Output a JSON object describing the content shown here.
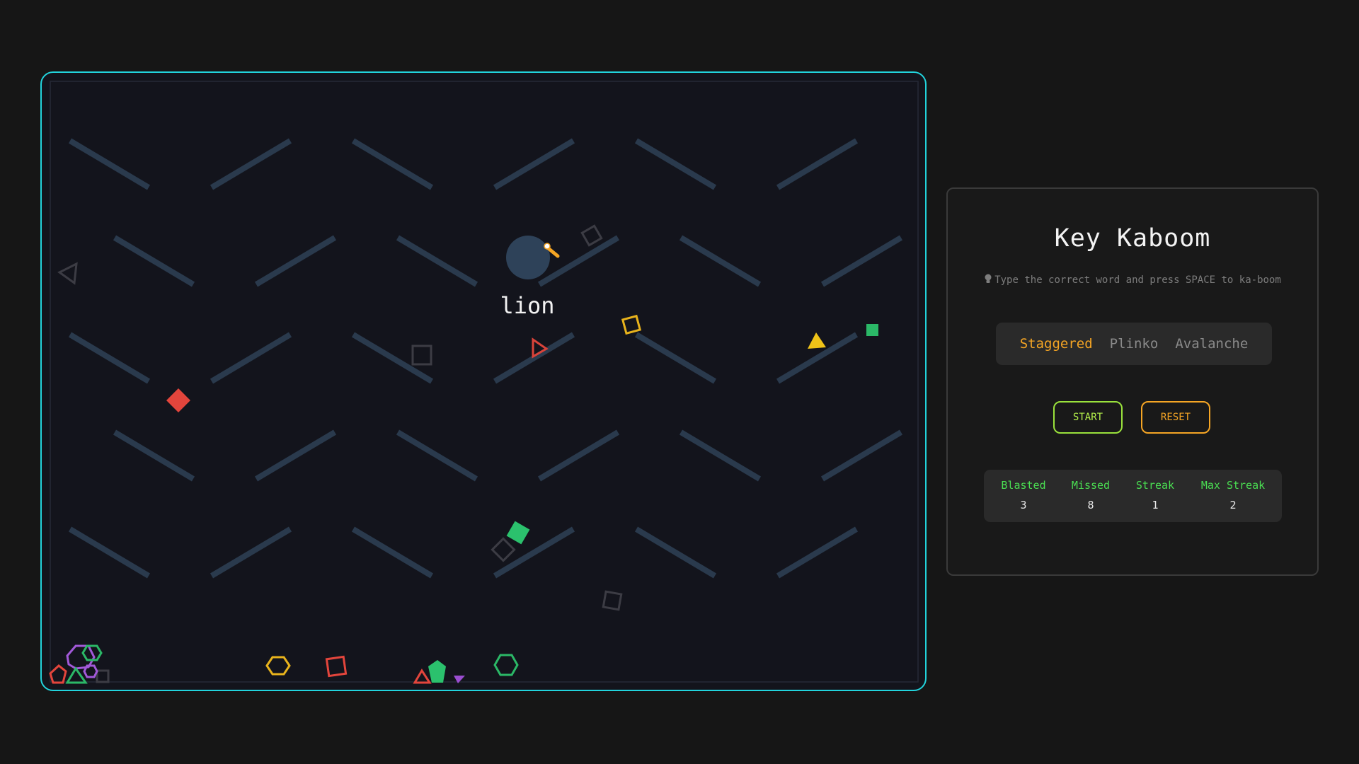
{
  "game": {
    "word": "lion",
    "colors": {
      "frame": "#22d3dc",
      "board": "#13141c",
      "peg": "#2a3a4d",
      "ball": "#2e4259",
      "fuse": "#f5a524"
    }
  },
  "panel": {
    "title": "Key Kaboom",
    "hint": "Type the correct word and press SPACE to ka-boom",
    "hint_icon": "lightbulb-icon",
    "modes": [
      {
        "label": "Staggered",
        "active": true
      },
      {
        "label": "Plinko",
        "active": false
      },
      {
        "label": "Avalanche",
        "active": false
      }
    ],
    "buttons": {
      "start": "START",
      "reset": "RESET"
    },
    "stats": [
      {
        "label": "Blasted",
        "value": "3"
      },
      {
        "label": "Missed",
        "value": "8"
      },
      {
        "label": "Streak",
        "value": "1"
      },
      {
        "label": "Max Streak",
        "value": "2"
      }
    ]
  }
}
